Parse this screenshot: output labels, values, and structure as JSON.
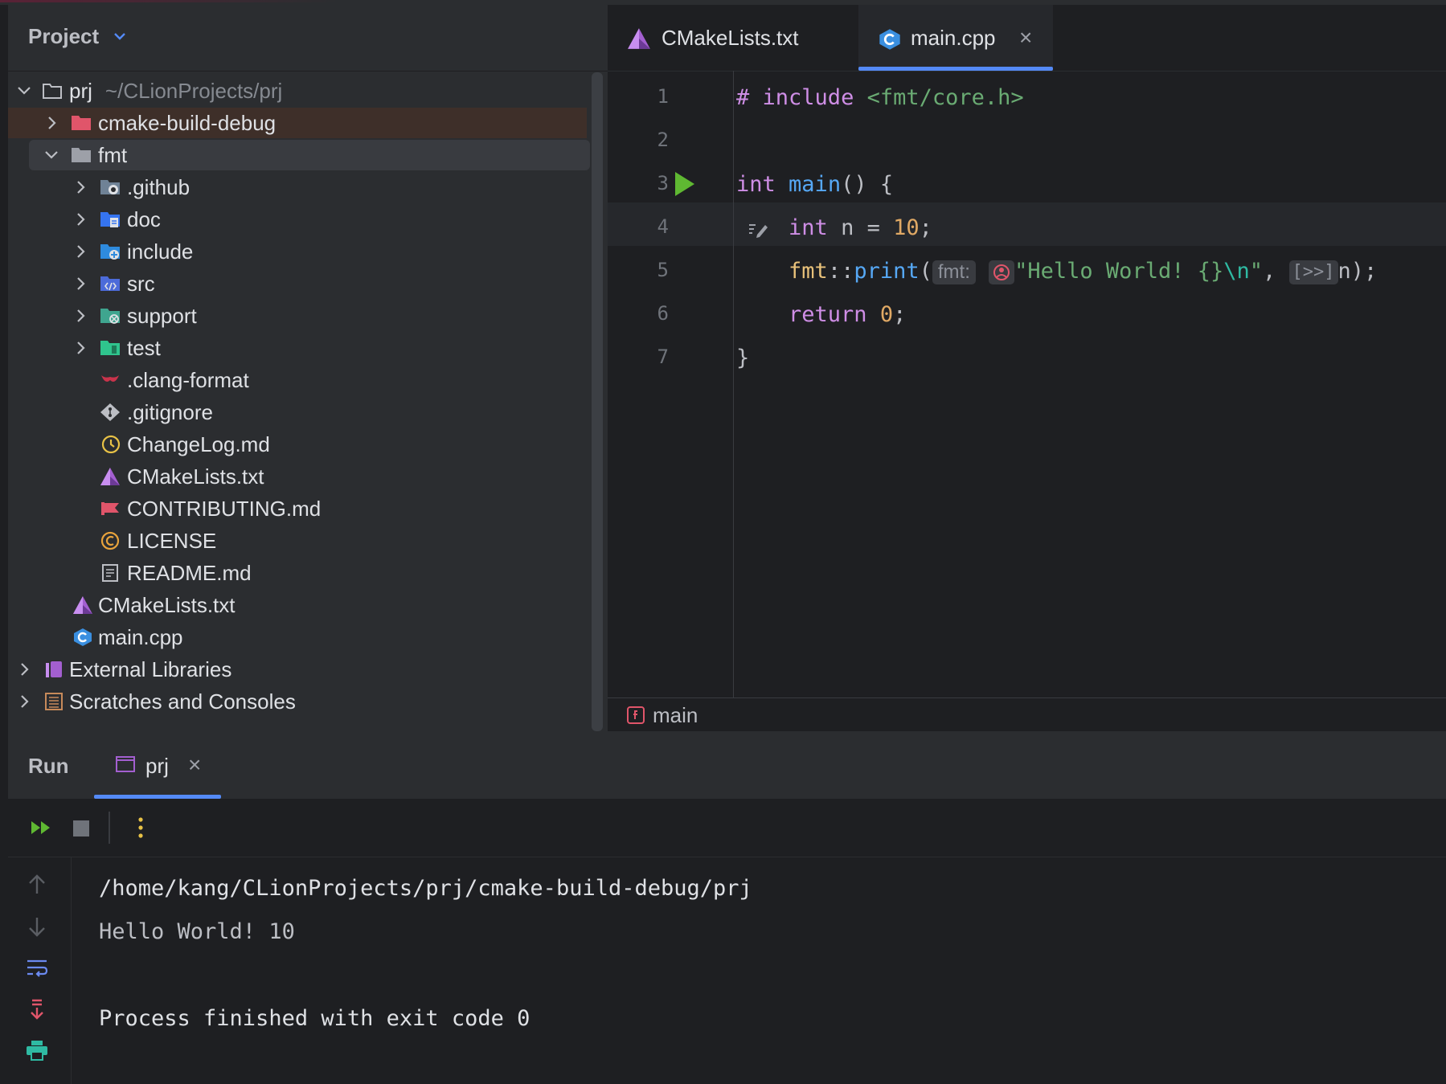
{
  "project": {
    "title": "Project",
    "tree": [
      {
        "label": "prj",
        "sub": "~/CLionProjects/prj",
        "depth": 0,
        "arrow": "down",
        "icon": "folder-outline-icon"
      },
      {
        "label": "cmake-build-debug",
        "depth": 1,
        "arrow": "right",
        "icon": "excluded-folder-icon"
      },
      {
        "label": "fmt",
        "depth": 1,
        "arrow": "down",
        "icon": "folder-icon"
      },
      {
        "label": ".github",
        "depth": 2,
        "arrow": "right",
        "icon": "github-folder-icon"
      },
      {
        "label": "doc",
        "depth": 2,
        "arrow": "right",
        "icon": "doc-folder-icon"
      },
      {
        "label": "include",
        "depth": 2,
        "arrow": "right",
        "icon": "include-folder-icon"
      },
      {
        "label": "src",
        "depth": 2,
        "arrow": "right",
        "icon": "src-folder-icon"
      },
      {
        "label": "support",
        "depth": 2,
        "arrow": "right",
        "icon": "support-folder-icon"
      },
      {
        "label": "test",
        "depth": 2,
        "arrow": "right",
        "icon": "test-folder-icon"
      },
      {
        "label": ".clang-format",
        "depth": 2,
        "icon": "clang-format-icon"
      },
      {
        "label": ".gitignore",
        "depth": 2,
        "icon": "git-icon"
      },
      {
        "label": "ChangeLog.md",
        "depth": 2,
        "icon": "changelog-icon"
      },
      {
        "label": "CMakeLists.txt",
        "depth": 2,
        "icon": "cmake-icon"
      },
      {
        "label": "CONTRIBUTING.md",
        "depth": 2,
        "icon": "contributing-icon"
      },
      {
        "label": "LICENSE",
        "depth": 2,
        "icon": "license-icon"
      },
      {
        "label": "README.md",
        "depth": 2,
        "icon": "readme-icon"
      },
      {
        "label": "CMakeLists.txt",
        "depth": 1,
        "icon": "cmake-icon"
      },
      {
        "label": "main.cpp",
        "depth": 1,
        "icon": "cpp-file-icon"
      },
      {
        "label": "External Libraries",
        "depth": 0,
        "arrow": "right",
        "icon": "libraries-icon"
      },
      {
        "label": "Scratches and Consoles",
        "depth": 0,
        "arrow": "right",
        "icon": "scratches-icon"
      }
    ]
  },
  "editor": {
    "tabs": [
      {
        "label": "CMakeLists.txt",
        "icon": "cmake-icon"
      },
      {
        "label": "main.cpp",
        "icon": "cpp-file-icon",
        "close": "×"
      }
    ],
    "line_numbers": [
      "1",
      "2",
      "3",
      "4",
      "5",
      "6",
      "7"
    ],
    "code": {
      "l1_hash": "#",
      "l1_include": "include",
      "l1_header": "<fmt/core.h>",
      "l3_int": "int",
      "l3_main": "main",
      "l3_rest": "() {",
      "l4_int": "int",
      "l4_rest": "n =",
      "l4_num": "10",
      "l4_semi": ";",
      "l5_ns": "fmt",
      "l5_sep": "::",
      "l5_fn": "print",
      "l5_paren": "(",
      "l5_hint": "fmt:",
      "l5_str1": "\"Hello World! {}",
      "l5_esc": "\\n",
      "l5_str2": "\"",
      "l5_comma": ",",
      "l5_hint2": "[>>]",
      "l5_end": "n);",
      "l6_return": "return",
      "l6_num": "0",
      "l6_semi": ";",
      "l7_brace": "}"
    },
    "breadcrumb": "main"
  },
  "run": {
    "title": "Run",
    "tab_label": "prj",
    "tab_close": "×",
    "output": [
      "/home/kang/CLionProjects/prj/cmake-build-debug/prj",
      "Hello World! 10",
      "",
      "Process finished with exit code 0"
    ]
  },
  "colors": {
    "accent": "#548af7",
    "run_green": "#5fb832",
    "keyword": "#cf8ee6",
    "function": "#56a8f5",
    "string": "#6aab73",
    "number": "#e0a965"
  }
}
